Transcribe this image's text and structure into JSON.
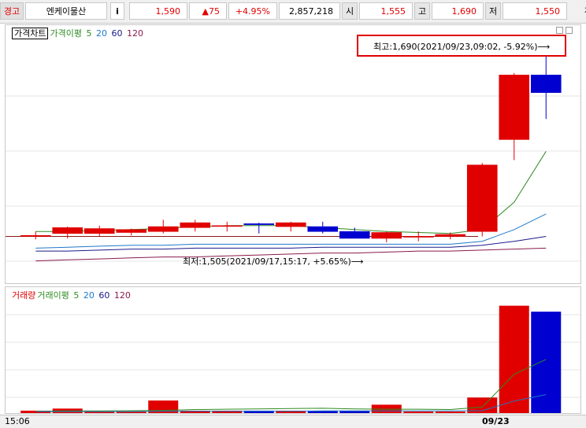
{
  "header": {
    "tag": "경고",
    "stock_name": "엔케이물산",
    "info_icon": "i",
    "price": "1,590",
    "change": "▲75",
    "change_pct": "+4.95%",
    "volume": "2,857,218",
    "open_label": "시",
    "open": "1,555",
    "high_label": "고",
    "high": "1,690",
    "low_label": "저",
    "low": "1,550",
    "trade_label": "체결강"
  },
  "price_legend": {
    "title": "가격차트",
    "ma_label": "가격이평",
    "ma": [
      "5",
      "20",
      "60",
      "120"
    ]
  },
  "volume_legend": {
    "title": "거래량",
    "ma_label": "거래이평",
    "ma": [
      "5",
      "20",
      "60",
      "120"
    ]
  },
  "annotations": {
    "high": "최고:1,690(2021/09/23,09:02, -5.92%)⟶",
    "low": "최저:1,505(2021/09/17,15:17, +5.65%)⟶"
  },
  "time_axis": {
    "start": "15:06",
    "date": "09/23"
  },
  "colors": {
    "up": "#e00000",
    "down": "#0000d0",
    "ma5": "#2e8b22",
    "ma20": "#1f78c8",
    "ma60": "#1a1a8c",
    "ma120": "#8b1a4a"
  },
  "chart_data": {
    "type": "candlestick",
    "price_range": [
      1470,
      1700
    ],
    "volume_range": [
      0,
      380000
    ],
    "candles": [
      {
        "o": 1505,
        "h": 1510,
        "l": 1502,
        "c": 1506,
        "v": 8000
      },
      {
        "o": 1508,
        "h": 1515,
        "l": 1503,
        "c": 1514,
        "v": 15000
      },
      {
        "o": 1508,
        "h": 1516,
        "l": 1505,
        "c": 1513,
        "v": 5000
      },
      {
        "o": 1509,
        "h": 1513,
        "l": 1506,
        "c": 1512,
        "v": 5000
      },
      {
        "o": 1510,
        "h": 1522,
        "l": 1508,
        "c": 1515,
        "v": 42000
      },
      {
        "o": 1514,
        "h": 1522,
        "l": 1510,
        "c": 1519,
        "v": 8000
      },
      {
        "o": 1516,
        "h": 1520,
        "l": 1510,
        "c": 1516,
        "v": 8000
      },
      {
        "o": 1518,
        "h": 1519,
        "l": 1508,
        "c": 1517,
        "v": 8000
      },
      {
        "o": 1515,
        "h": 1520,
        "l": 1510,
        "c": 1519,
        "v": 8000
      },
      {
        "o": 1515,
        "h": 1520,
        "l": 1508,
        "c": 1510,
        "v": 8000
      },
      {
        "o": 1510,
        "h": 1514,
        "l": 1505,
        "c": 1503,
        "v": 8000
      },
      {
        "o": 1503,
        "h": 1510,
        "l": 1499,
        "c": 1509,
        "v": 28000
      },
      {
        "o": 1505,
        "h": 1510,
        "l": 1500,
        "c": 1505,
        "v": 5000
      },
      {
        "o": 1505,
        "h": 1509,
        "l": 1502,
        "c": 1507,
        "v": 5000
      },
      {
        "o": 1510,
        "h": 1580,
        "l": 1505,
        "c": 1578,
        "v": 52000
      },
      {
        "o": 1604,
        "h": 1672,
        "l": 1583,
        "c": 1670,
        "v": 360000
      },
      {
        "o": 1670,
        "h": 1690,
        "l": 1625,
        "c": 1652,
        "v": 340000
      }
    ],
    "ma_price": {
      "5": [
        1510,
        1510,
        1511,
        1512,
        1513,
        1515,
        1516,
        1516,
        1516,
        1514,
        1512,
        1510,
        1509,
        1508,
        1512,
        1540,
        1592
      ],
      "20": [
        1493,
        1494,
        1495,
        1496,
        1496,
        1497,
        1497,
        1497,
        1497,
        1497,
        1497,
        1497,
        1497,
        1497,
        1500,
        1512,
        1528
      ],
      "60": [
        1490,
        1490,
        1491,
        1492,
        1492,
        1493,
        1493,
        1493,
        1493,
        1494,
        1494,
        1494,
        1494,
        1494,
        1496,
        1500,
        1505
      ],
      "120": [
        1480,
        1481,
        1482,
        1483,
        1484,
        1484,
        1485,
        1486,
        1487,
        1488,
        1488,
        1489,
        1490,
        1490,
        1491,
        1492,
        1493
      ]
    },
    "ma_volume": {
      "5": [
        6000,
        7000,
        7000,
        8000,
        9000,
        12000,
        13000,
        14000,
        15000,
        16000,
        14000,
        13000,
        13000,
        12000,
        20000,
        130000,
        180000
      ],
      "20": [
        5000,
        5000,
        5000,
        5000,
        6000,
        6000,
        6000,
        6000,
        6000,
        7000,
        7000,
        7000,
        7000,
        7000,
        8000,
        40000,
        62000
      ]
    }
  }
}
